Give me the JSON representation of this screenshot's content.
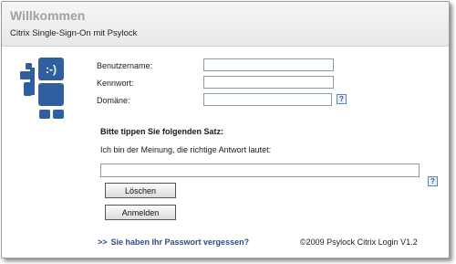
{
  "header": {
    "title": "Willkommen",
    "subtitle": "Citrix Single-Sign-On mit Psylock"
  },
  "logo": {
    "icon": "psylock-keyboard-smiley-logo",
    "smiley": ":-)"
  },
  "form": {
    "username_label": "Benutzername:",
    "username_value": "",
    "password_label": "Kennwort:",
    "password_value": "",
    "domain_label": "Domäne:",
    "domain_value": "",
    "help_glyph": "?"
  },
  "typing": {
    "heading": "Bitte tippen Sie folgenden Satz:",
    "sentence": "Ich bin der Meinung, die richtige Antwort lautet:",
    "input_value": ""
  },
  "buttons": {
    "clear_label": "Löschen",
    "login_label": "Anmelden"
  },
  "footer": {
    "forgot_arrows": ">>",
    "forgot_label": "Sie haben Ihr Passwort vergessen?",
    "copyright": "©2009 Psylock Citrix Login V1.2"
  },
  "colors": {
    "accent": "#2b4f86",
    "logo_blue": "#2f5f9e",
    "title_gray": "#9ea2a6"
  }
}
